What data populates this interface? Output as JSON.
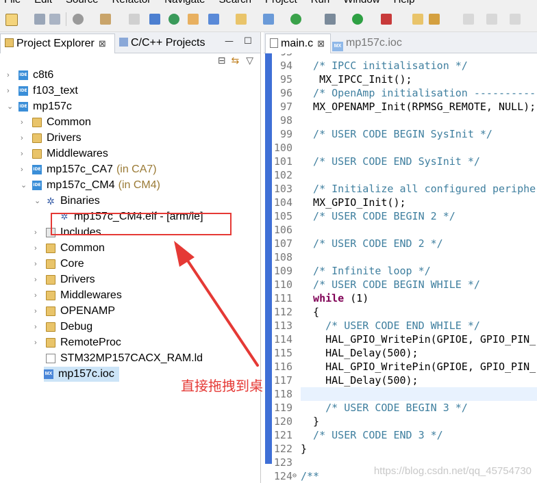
{
  "menu": [
    "File",
    "Edit",
    "Source",
    "Refactor",
    "Navigate",
    "Search",
    "Project",
    "Run",
    "Window",
    "Help"
  ],
  "left_tabs": {
    "project_explorer": "Project Explorer",
    "project_explorer_close": "⊠",
    "cc_projects": "C/C++ Projects",
    "minimize": "—",
    "maximize": "☐"
  },
  "tree": [
    {
      "label": "c8t6",
      "icon": "ide-project-icon",
      "expanded": false,
      "depth": 0
    },
    {
      "label": "f103_text",
      "icon": "ide-project-icon",
      "expanded": false,
      "depth": 0
    },
    {
      "label": "mp157c",
      "icon": "ide-project-icon",
      "expanded": true,
      "depth": 0
    },
    {
      "label": "Common",
      "icon": "folder-icon",
      "expanded": false,
      "depth": 1
    },
    {
      "label": "Drivers",
      "icon": "folder-icon",
      "expanded": false,
      "depth": 1
    },
    {
      "label": "Middlewares",
      "icon": "folder-icon",
      "expanded": false,
      "depth": 1
    },
    {
      "label": "mp157c_CA7",
      "hint": "(in CA7)",
      "icon": "ide-project-icon",
      "expanded": false,
      "depth": 1
    },
    {
      "label": "mp157c_CM4",
      "hint": "(in CM4)",
      "icon": "ide-project-icon",
      "expanded": true,
      "depth": 1
    },
    {
      "label": "Binaries",
      "icon": "binaries-icon",
      "expanded": true,
      "depth": 2
    },
    {
      "label": "mp157c_CM4.elf - [arm/le]",
      "icon": "elf-gear-icon",
      "depth": 3
    },
    {
      "label": "Includes",
      "icon": "includes-icon",
      "expanded": false,
      "depth": 2
    },
    {
      "label": "Common",
      "icon": "source-folder-icon",
      "expanded": false,
      "depth": 2
    },
    {
      "label": "Core",
      "icon": "source-folder-icon",
      "expanded": false,
      "depth": 2
    },
    {
      "label": "Drivers",
      "icon": "folder-icon",
      "expanded": false,
      "depth": 2
    },
    {
      "label": "Middlewares",
      "icon": "folder-icon",
      "expanded": false,
      "depth": 2
    },
    {
      "label": "OPENAMP",
      "icon": "folder-icon",
      "expanded": false,
      "depth": 2
    },
    {
      "label": "Debug",
      "icon": "folder-icon",
      "expanded": false,
      "depth": 2
    },
    {
      "label": "RemoteProc",
      "icon": "folder-icon",
      "expanded": false,
      "depth": 2
    },
    {
      "label": "STM32MP157CACX_RAM.ld",
      "icon": "linker-file-icon",
      "depth": 2
    },
    {
      "label": "mp157c.ioc",
      "icon": "mx-file-icon",
      "depth": 1,
      "selected": true
    }
  ],
  "annotation": "直接拖拽到桌面",
  "editor_tabs": [
    {
      "label": "main.c",
      "close": "⊠",
      "active": true
    },
    {
      "label": "mp157c.ioc",
      "active": false
    }
  ],
  "code_lines": [
    {
      "n": "93",
      "t": ""
    },
    {
      "n": "94",
      "t": "  /* IPCC initialisation */"
    },
    {
      "n": "95",
      "t": "   MX_IPCC_Init();"
    },
    {
      "n": "96",
      "t": "  /* OpenAmp initialisation ------------"
    },
    {
      "n": "97",
      "t": "  MX_OPENAMP_Init(RPMSG_REMOTE, NULL);"
    },
    {
      "n": "98",
      "t": ""
    },
    {
      "n": "99",
      "t": "  /* USER CODE BEGIN SysInit */"
    },
    {
      "n": "100",
      "t": ""
    },
    {
      "n": "101",
      "t": "  /* USER CODE END SysInit */"
    },
    {
      "n": "102",
      "t": ""
    },
    {
      "n": "103",
      "t": "  /* Initialize all configured peripher"
    },
    {
      "n": "104",
      "t": "  MX_GPIO_Init();"
    },
    {
      "n": "105",
      "t": "  /* USER CODE BEGIN 2 */"
    },
    {
      "n": "106",
      "t": ""
    },
    {
      "n": "107",
      "t": "  /* USER CODE END 2 */"
    },
    {
      "n": "108",
      "t": ""
    },
    {
      "n": "109",
      "t": "  /* Infinite loop */"
    },
    {
      "n": "110",
      "t": "  /* USER CODE BEGIN WHILE */"
    },
    {
      "n": "111",
      "t": "  while (1)"
    },
    {
      "n": "112",
      "t": "  {"
    },
    {
      "n": "113",
      "t": "    /* USER CODE END WHILE */"
    },
    {
      "n": "114",
      "t": "    HAL_GPIO_WritePin(GPIOE, GPIO_PIN_"
    },
    {
      "n": "115",
      "t": "    HAL_Delay(500);"
    },
    {
      "n": "116",
      "t": "    HAL_GPIO_WritePin(GPIOE, GPIO_PIN_"
    },
    {
      "n": "117",
      "t": "    HAL_Delay(500);"
    },
    {
      "n": "118",
      "t": ""
    },
    {
      "n": "119",
      "t": "    /* USER CODE BEGIN 3 */"
    },
    {
      "n": "120",
      "t": "  }"
    },
    {
      "n": "121",
      "t": "  /* USER CODE END 3 */"
    },
    {
      "n": "122",
      "t": "}"
    },
    {
      "n": "123",
      "t": ""
    },
    {
      "n": "124",
      "t": "/**"
    }
  ],
  "watermark": "https://blog.csdn.net/qq_45754730",
  "colors": {
    "annotation": "#e53935",
    "comment": "#3f7f9f",
    "keyword": "#7f0055",
    "selection": "#cce4f7",
    "marker_bar": "#3f6fd6"
  }
}
